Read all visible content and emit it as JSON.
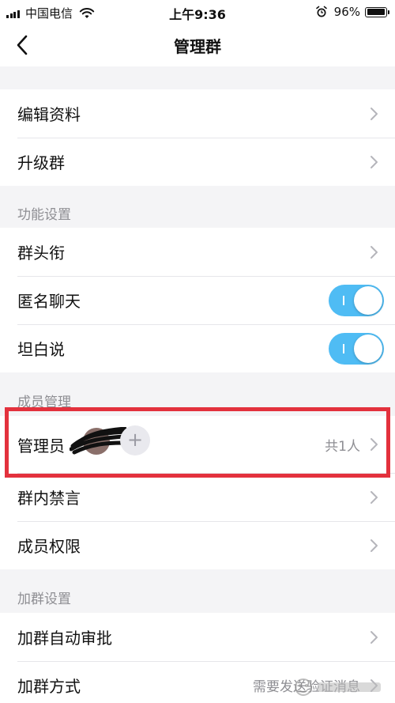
{
  "status_bar": {
    "carrier": "中国电信",
    "time": "上午9:36",
    "battery": "96%",
    "battery_level": 0.96
  },
  "nav": {
    "title": "管理群"
  },
  "section_basic": {
    "items": [
      {
        "label": "编辑资料"
      },
      {
        "label": "升级群"
      }
    ]
  },
  "section_function": {
    "header": "功能设置",
    "items": [
      {
        "label": "群头衔"
      },
      {
        "label": "匿名聊天",
        "toggle": true
      },
      {
        "label": "坦白说",
        "toggle": true
      }
    ]
  },
  "section_members": {
    "header": "成员管理",
    "items": [
      {
        "label": "管理员",
        "value": "共1人"
      },
      {
        "label": "群内禁言"
      },
      {
        "label": "成员权限"
      }
    ]
  },
  "section_join": {
    "header": "加群设置",
    "items": [
      {
        "label": "加群自动审批"
      },
      {
        "label": "加群方式",
        "value": "需要发送验证消息"
      }
    ]
  },
  "colors": {
    "accent": "#4fbcf4",
    "highlight": "#e3313d",
    "background": "#f4f4f6"
  },
  "icons": {
    "back": "chevron-left-icon",
    "chevron": "chevron-right-icon",
    "add": "plus-icon"
  }
}
